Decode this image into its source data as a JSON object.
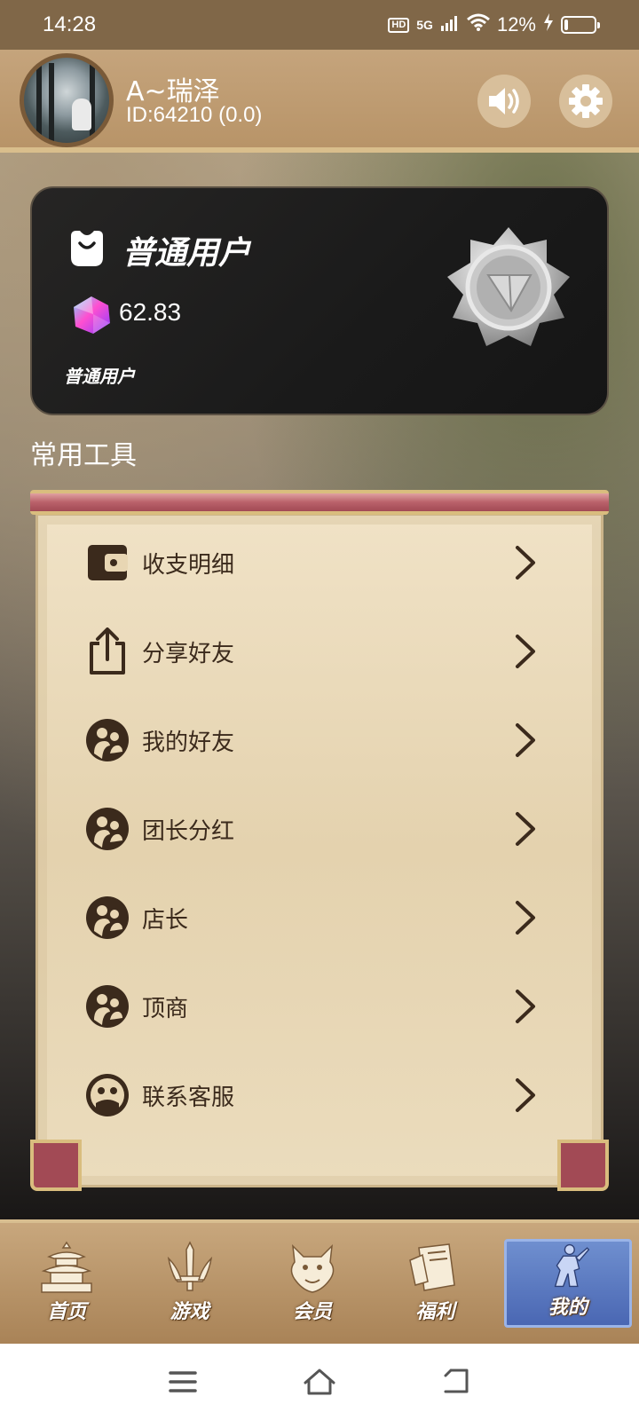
{
  "status_bar": {
    "time": "14:28",
    "hd": "HD",
    "network": "5G",
    "battery": "12%",
    "battery_level": 0.12
  },
  "header": {
    "username": "A~瑞泽",
    "user_id": "ID:64210 (0.0)",
    "icons": {
      "sound": "speaker-icon",
      "settings": "gear-icon"
    }
  },
  "member_card": {
    "tier": "普通用户",
    "points": "62.83",
    "tier_sub": "普通用户",
    "icons": {
      "tier": "bag-icon",
      "gem": "gem-icon",
      "medal": "silver-medal-icon"
    }
  },
  "tools": {
    "heading": "常用工具",
    "items": [
      {
        "label": "收支明细",
        "icon": "wallet-icon"
      },
      {
        "label": "分享好友",
        "icon": "share-icon"
      },
      {
        "label": "我的好友",
        "icon": "friends-icon"
      },
      {
        "label": "团长分红",
        "icon": "friends-icon"
      },
      {
        "label": "店长",
        "icon": "friends-icon"
      },
      {
        "label": "顶商",
        "icon": "friends-icon"
      },
      {
        "label": "联系客服",
        "icon": "service-icon"
      }
    ]
  },
  "bottom_nav": {
    "items": [
      {
        "label": "首页",
        "icon": "pagoda-icon"
      },
      {
        "label": "游戏",
        "icon": "sword-icon"
      },
      {
        "label": "会员",
        "icon": "dragon-icon"
      },
      {
        "label": "福利",
        "icon": "card-icon"
      },
      {
        "label": "我的",
        "icon": "warrior-icon"
      }
    ],
    "active": "我的",
    "colors": {
      "active_bg": "#5a78c2",
      "bar_bg": "#b8946a"
    }
  },
  "system_nav": {
    "icons": [
      "menu-icon",
      "home-icon",
      "back-icon"
    ]
  }
}
